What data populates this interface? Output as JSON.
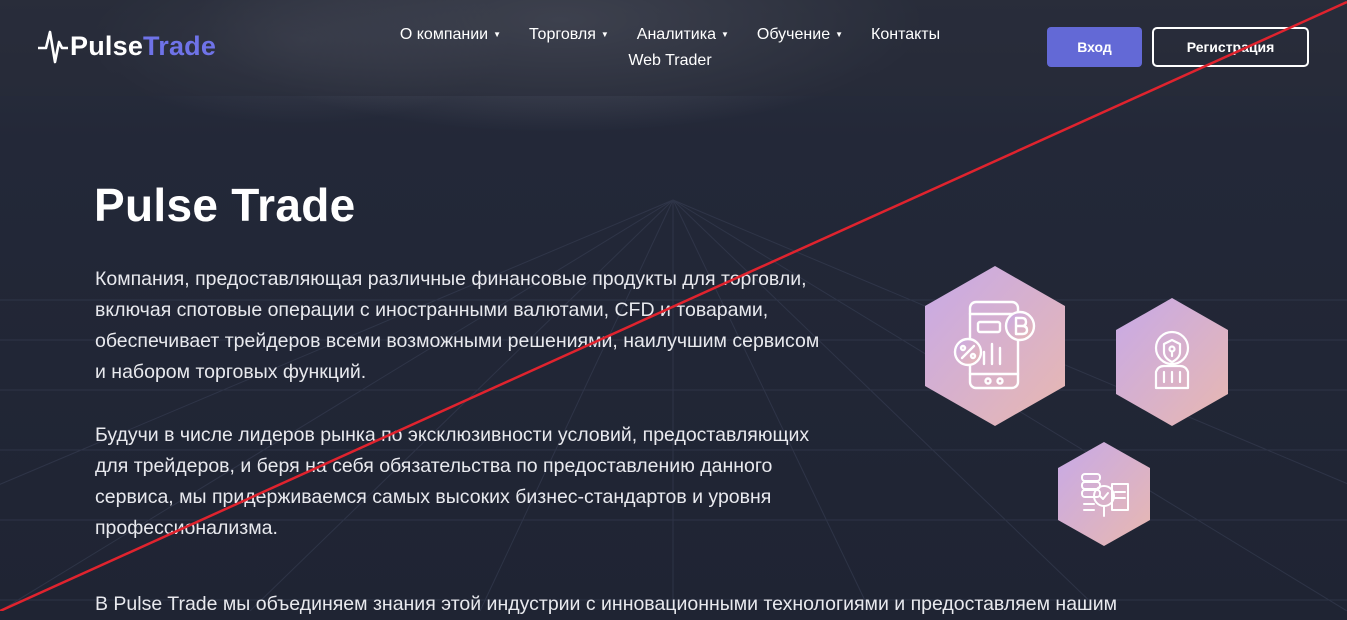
{
  "header": {
    "logo": {
      "word1": "Pulse",
      "word2": "Trade"
    },
    "nav": [
      {
        "label": "О компании",
        "has_dropdown": true
      },
      {
        "label": "Торговля",
        "has_dropdown": true
      },
      {
        "label": "Аналитика",
        "has_dropdown": true
      },
      {
        "label": "Обучение",
        "has_dropdown": true
      },
      {
        "label": "Контакты",
        "has_dropdown": false
      }
    ],
    "nav_second_row": {
      "label": "Web Trader"
    },
    "login_label": "Вход",
    "register_label": "Регистрация"
  },
  "main": {
    "title": "Pulse Trade",
    "paragraphs": [
      "Компания, предоставляющая различные финансовые продукты для торговли, включая спотовые операции с иностранными валютами, CFD и товарами, обеспечивает трейдеров всеми возможными решениями, наилучшим сервисом и набором торговых функций.",
      "Будучи в числе лидеров рынка по эксклюзивности условий, предоставляющих для трейдеров, и беря на себя обязательства по предоставлению данного сервиса, мы придерживаемся самых высоких бизнес-стандартов и уровня профессионализма.",
      "В Pulse Trade мы объединяем знания этой индустрии с инновационными технологиями и предоставляем нашим"
    ],
    "icons": [
      "mobile-trading-icon",
      "security-shield-icon",
      "analysis-docs-icon"
    ]
  },
  "colors": {
    "background": "#1f2433",
    "accent": "#6369d6",
    "logo_accent": "#6f73e8",
    "hex_gradient_start": "#c7a9e8",
    "hex_gradient_end": "#e8b8b0",
    "strike_line": "#e0232e"
  }
}
